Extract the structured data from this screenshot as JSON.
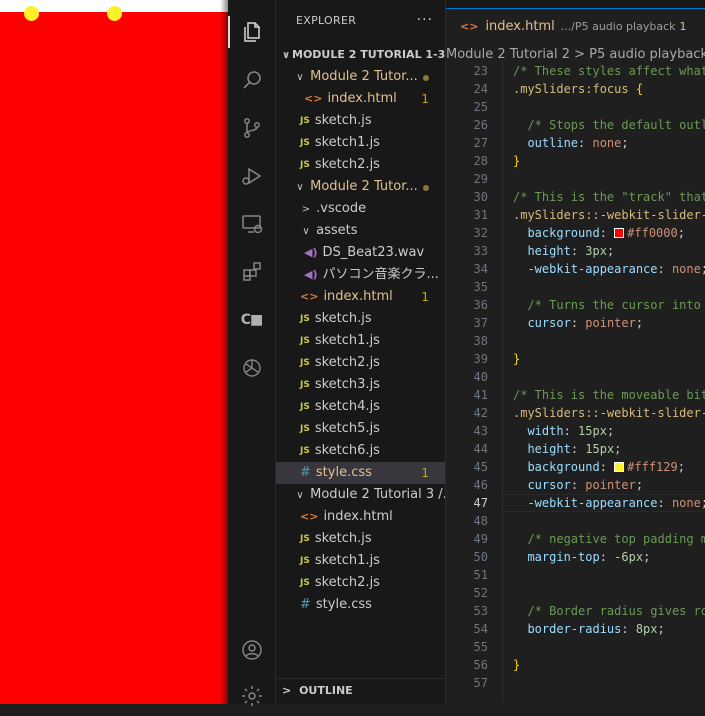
{
  "explorer": {
    "title": "EXPLORER",
    "more": "···",
    "root_label": "MODULE 2 TUTORIAL 1-3",
    "outline_label": "OUTLINE",
    "items": [
      {
        "label": "Module 2 Tutor...",
        "type": "folder"
      },
      {
        "label": "index.html",
        "type": "html",
        "badge": "1"
      },
      {
        "label": "sketch.js",
        "type": "js"
      },
      {
        "label": "sketch1.js",
        "type": "js"
      },
      {
        "label": "sketch2.js",
        "type": "js"
      },
      {
        "label": "Module 2 Tutor...",
        "type": "folder"
      },
      {
        "label": ".vscode",
        "type": "folder-collapsed"
      },
      {
        "label": "assets",
        "type": "folder"
      },
      {
        "label": "DS_Beat23.wav",
        "type": "wav"
      },
      {
        "label": "パソコン音楽クラ...",
        "type": "wav"
      },
      {
        "label": "index.html",
        "type": "html",
        "badge": "1"
      },
      {
        "label": "sketch.js",
        "type": "js"
      },
      {
        "label": "sketch1.js",
        "type": "js"
      },
      {
        "label": "sketch2.js",
        "type": "js"
      },
      {
        "label": "sketch3.js",
        "type": "js"
      },
      {
        "label": "sketch4.js",
        "type": "js"
      },
      {
        "label": "sketch5.js",
        "type": "js"
      },
      {
        "label": "sketch6.js",
        "type": "js"
      },
      {
        "label": "style.css",
        "type": "css",
        "badge": "1"
      },
      {
        "label": "Module 2 Tutorial 3 /...",
        "type": "folder"
      },
      {
        "label": "index.html",
        "type": "html"
      },
      {
        "label": "sketch.js",
        "type": "js"
      },
      {
        "label": "sketch1.js",
        "type": "js"
      },
      {
        "label": "sketch2.js",
        "type": "js"
      },
      {
        "label": "style.css",
        "type": "css"
      }
    ]
  },
  "icons": {
    "js": "JS",
    "html": "<>",
    "css": "#",
    "wav": "◀)",
    "chev_down": "∨",
    "chev_right": ">"
  },
  "tab": {
    "name": "index.html",
    "path": ".../P5 audio playback",
    "count": "1"
  },
  "breadcrumb": "Module 2 Tutorial 2 > P5 audio playback >",
  "colors": {
    "slider_track": "#ff0000",
    "slider_thumb": "#fff129",
    "canvas_bg": "#ff0000",
    "accent": "#0078d4"
  },
  "code": {
    "current_line": "47",
    "lines": [
      {
        "n": "23",
        "t": "/* These styles affect what",
        "k": "cm"
      },
      {
        "n": "24",
        "t": ".mySliders:focus {",
        "k": "sel"
      },
      {
        "n": "25",
        "t": "",
        "k": "pu"
      },
      {
        "n": "26",
        "t": "  /* Stops the default outl",
        "k": "cm"
      },
      {
        "n": "27",
        "t": "  outline: none;",
        "k": "decl"
      },
      {
        "n": "28",
        "t": "}",
        "k": "br"
      },
      {
        "n": "29",
        "t": "",
        "k": "pu"
      },
      {
        "n": "30",
        "t": "/* This is the \"track\" that",
        "k": "cm"
      },
      {
        "n": "31",
        "t": ".mySliders::-webkit-slider-",
        "k": "sel"
      },
      {
        "n": "32",
        "t": "  background: #ff0000;",
        "k": "decl",
        "swatch": "#ff0000"
      },
      {
        "n": "33",
        "t": "  height: 3px;",
        "k": "decl"
      },
      {
        "n": "34",
        "t": "  -webkit-appearance: none;",
        "k": "decl"
      },
      {
        "n": "35",
        "t": "",
        "k": "pu"
      },
      {
        "n": "36",
        "t": "  /* Turns the cursor into",
        "k": "cm"
      },
      {
        "n": "37",
        "t": "  cursor: pointer;",
        "k": "decl"
      },
      {
        "n": "38",
        "t": "",
        "k": "pu"
      },
      {
        "n": "39",
        "t": "}",
        "k": "br"
      },
      {
        "n": "40",
        "t": "",
        "k": "pu"
      },
      {
        "n": "41",
        "t": "/* This is the moveable bit",
        "k": "cm"
      },
      {
        "n": "42",
        "t": ".mySliders::-webkit-slider-",
        "k": "sel"
      },
      {
        "n": "43",
        "t": "  width: 15px;",
        "k": "decl"
      },
      {
        "n": "44",
        "t": "  height: 15px;",
        "k": "decl"
      },
      {
        "n": "45",
        "t": "  background: #fff129;",
        "k": "decl",
        "swatch": "#fff129"
      },
      {
        "n": "46",
        "t": "  cursor: pointer;",
        "k": "decl"
      },
      {
        "n": "47",
        "t": "  -webkit-appearance: none;",
        "k": "decl"
      },
      {
        "n": "48",
        "t": "",
        "k": "pu"
      },
      {
        "n": "49",
        "t": "  /* negative top padding m",
        "k": "cm"
      },
      {
        "n": "50",
        "t": "  margin-top: -6px;",
        "k": "decl"
      },
      {
        "n": "51",
        "t": "",
        "k": "pu"
      },
      {
        "n": "52",
        "t": "",
        "k": "pu"
      },
      {
        "n": "53",
        "t": "  /* Border radius gives ro",
        "k": "cm"
      },
      {
        "n": "54",
        "t": "  border-radius: 8px;",
        "k": "decl"
      },
      {
        "n": "55",
        "t": "",
        "k": "pu"
      },
      {
        "n": "56",
        "t": "}",
        "k": "br"
      },
      {
        "n": "57",
        "t": "",
        "k": "pu"
      }
    ]
  }
}
